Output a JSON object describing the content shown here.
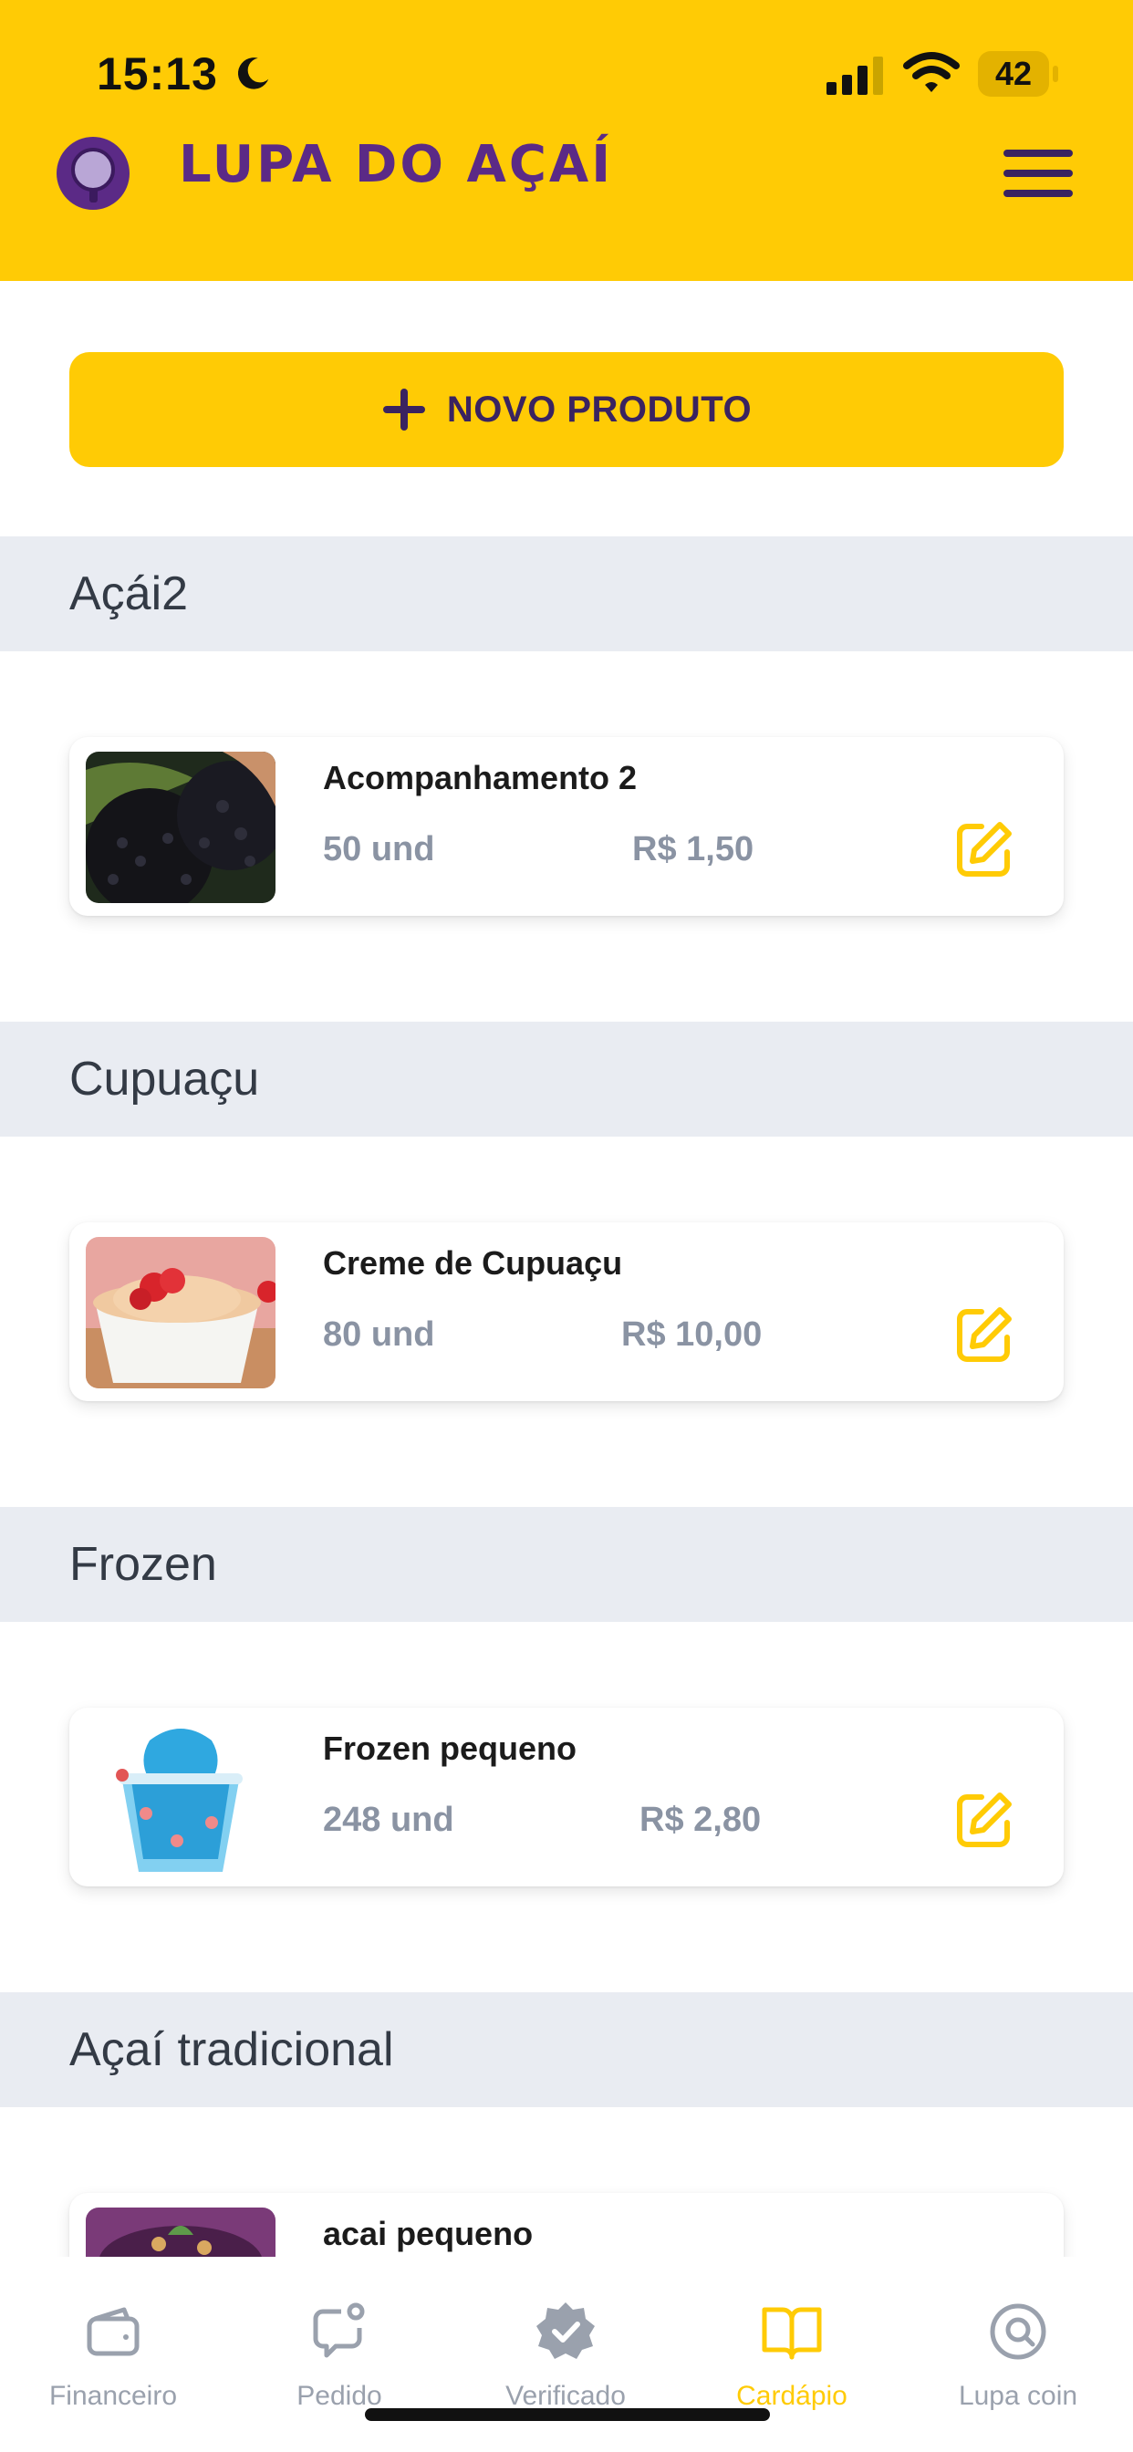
{
  "status": {
    "time": "15:13",
    "battery": "42"
  },
  "header": {
    "brand": "LUPA DO AÇAÍ"
  },
  "toolbar": {
    "new_product_label": "NOVO PRODUTO"
  },
  "categories": [
    {
      "name": "Açái2",
      "products": [
        {
          "name": "Acompanhamento 2",
          "qty": "50 und",
          "price": "R$ 1,50"
        }
      ]
    },
    {
      "name": "Cupuaçu",
      "products": [
        {
          "name": "Creme de Cupuaçu",
          "qty": "80 und",
          "price": "R$ 10,00"
        }
      ]
    },
    {
      "name": "Frozen",
      "products": [
        {
          "name": "Frozen pequeno",
          "qty": "248 und",
          "price": "R$ 2,80"
        }
      ]
    },
    {
      "name": "Açaí tradicional",
      "products": [
        {
          "name": "acai pequeno"
        }
      ]
    }
  ],
  "tabs": [
    {
      "label": "Financeiro",
      "icon": "wallet-icon"
    },
    {
      "label": "Pedido",
      "icon": "chat-bubble-icon"
    },
    {
      "label": "Verificado",
      "icon": "verified-badge-icon"
    },
    {
      "label": "Cardápio",
      "icon": "book-icon",
      "active": true
    },
    {
      "label": "Lupa coin",
      "icon": "at-sign-icon"
    }
  ],
  "colors": {
    "brand_yellow": "#FFCB05",
    "brand_purple": "#5B2A86",
    "muted_text": "#8A93A3",
    "section_bg": "#E9ECF2"
  }
}
